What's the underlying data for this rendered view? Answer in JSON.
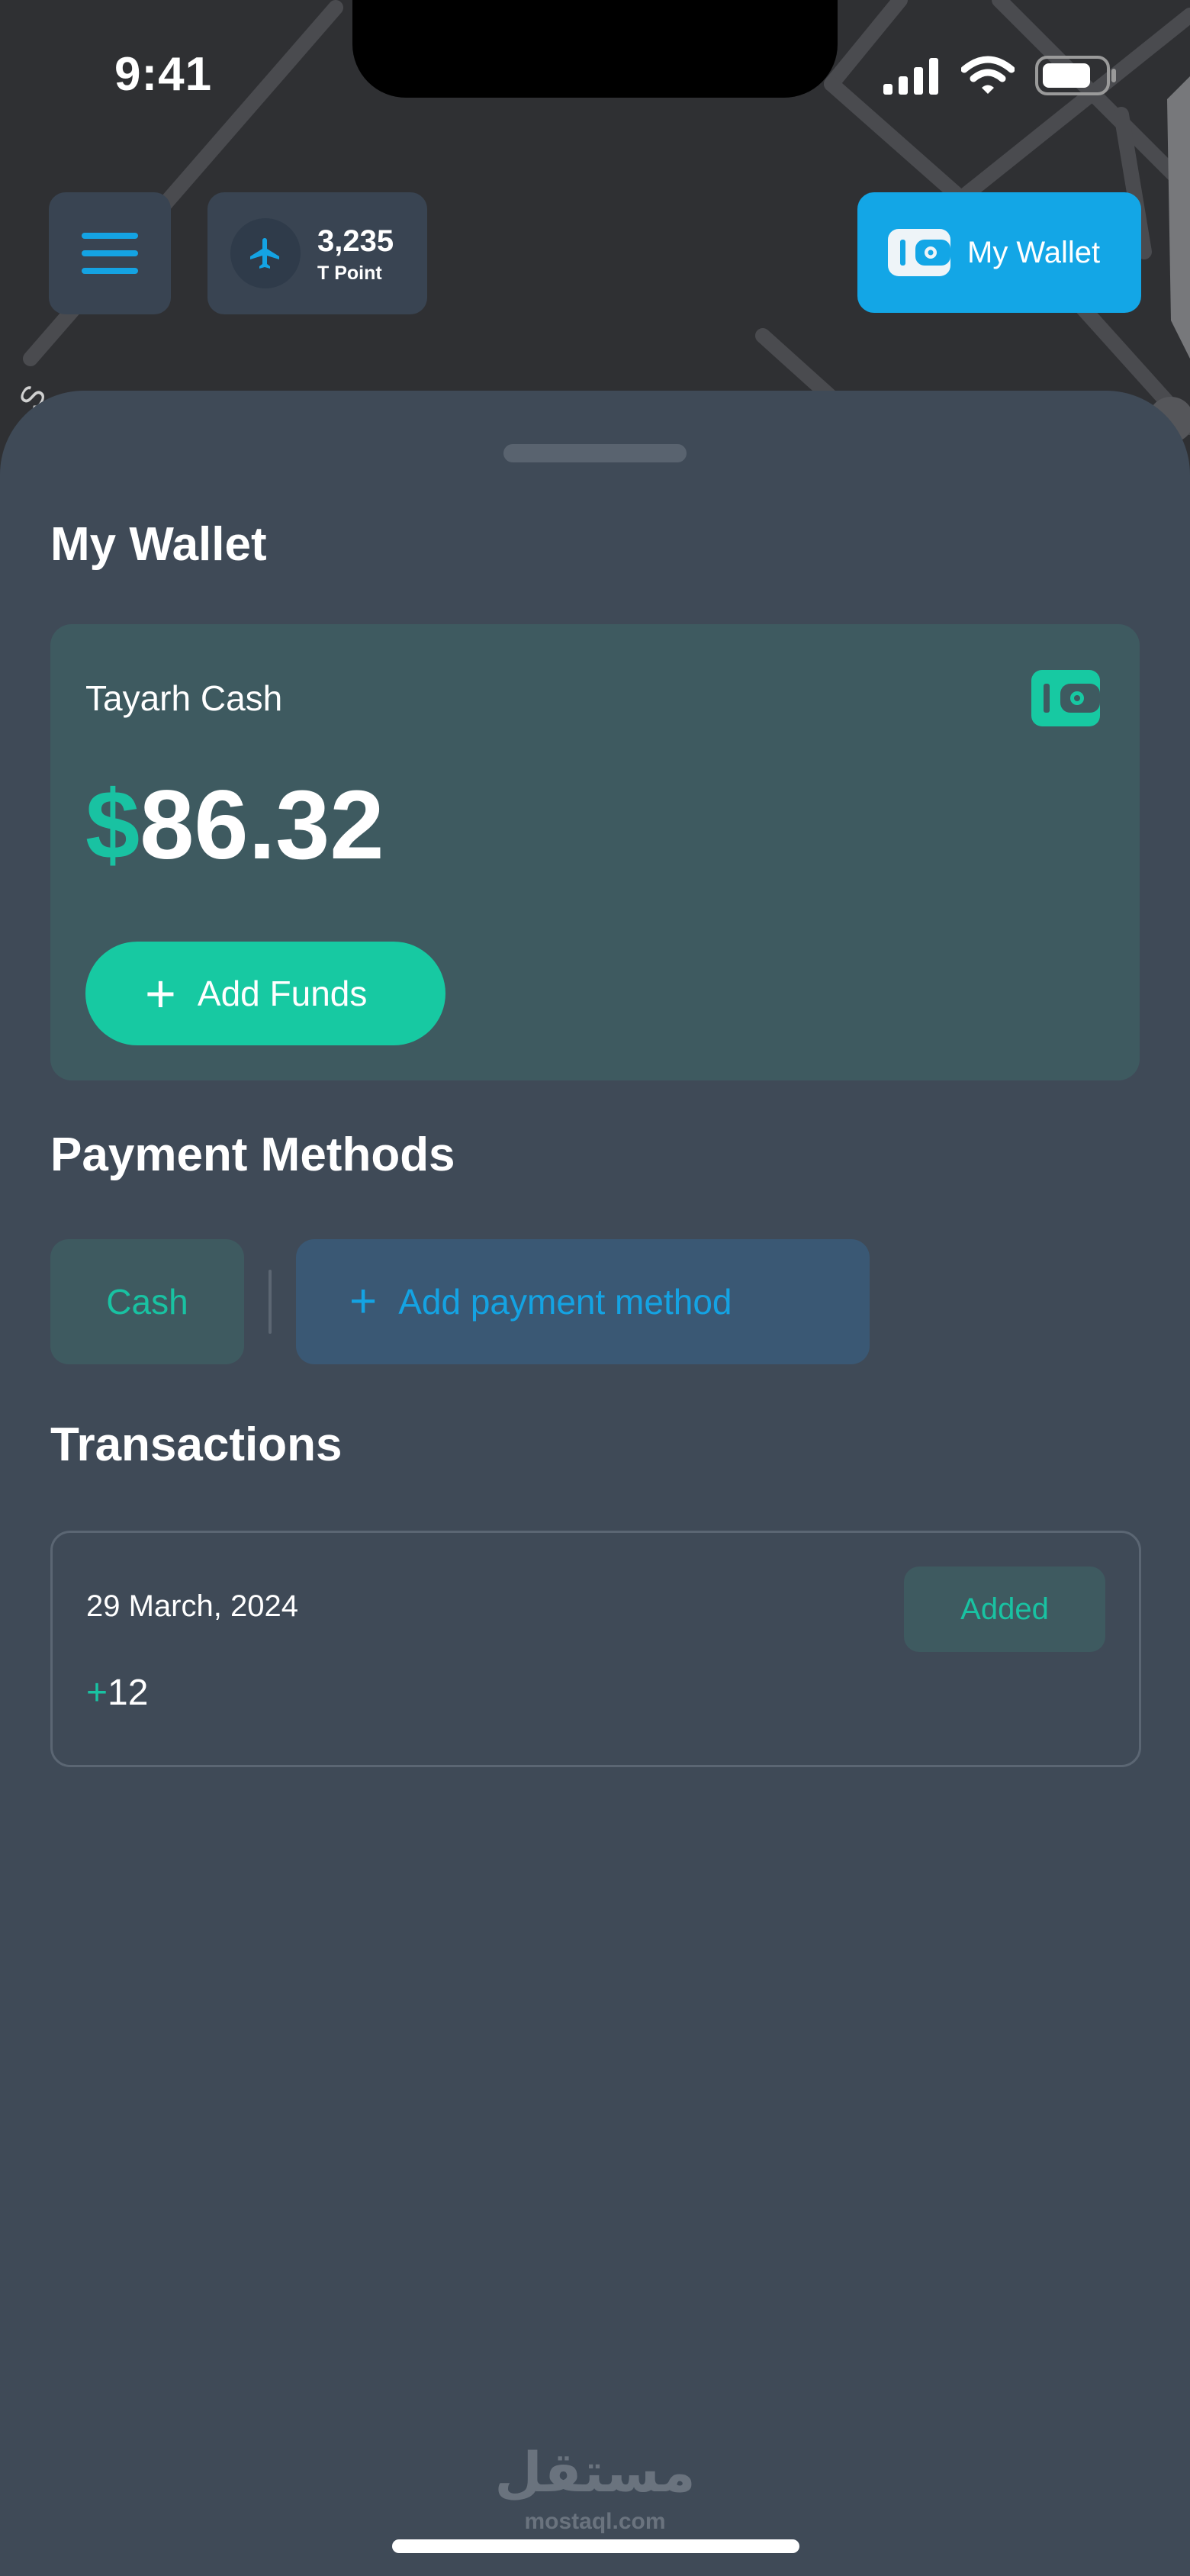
{
  "status_bar": {
    "time": "9:41"
  },
  "header": {
    "points": {
      "value": "3,235",
      "label": "T Point"
    },
    "wallet_button_label": "My Wallet"
  },
  "wallet": {
    "title": "My Wallet",
    "card": {
      "label": "Tayarh Cash",
      "currency": "$",
      "amount": "86.32",
      "add_funds_label": "Add Funds"
    }
  },
  "payment_methods": {
    "title": "Payment Methods",
    "items": [
      "Cash"
    ],
    "add_label": "Add payment method"
  },
  "transactions": {
    "title": "Transactions",
    "items": [
      {
        "date": "29 March, 2024",
        "status": "Added",
        "sign": "+",
        "amount": "12"
      }
    ]
  },
  "watermark": {
    "arabic": "مستقل",
    "latin": "mostaql.com"
  },
  "colors": {
    "accent_teal": "#17c9a2",
    "accent_blue": "#13a6e6",
    "sheet_bg": "#3f4a57",
    "map_bg": "#2f3033"
  }
}
